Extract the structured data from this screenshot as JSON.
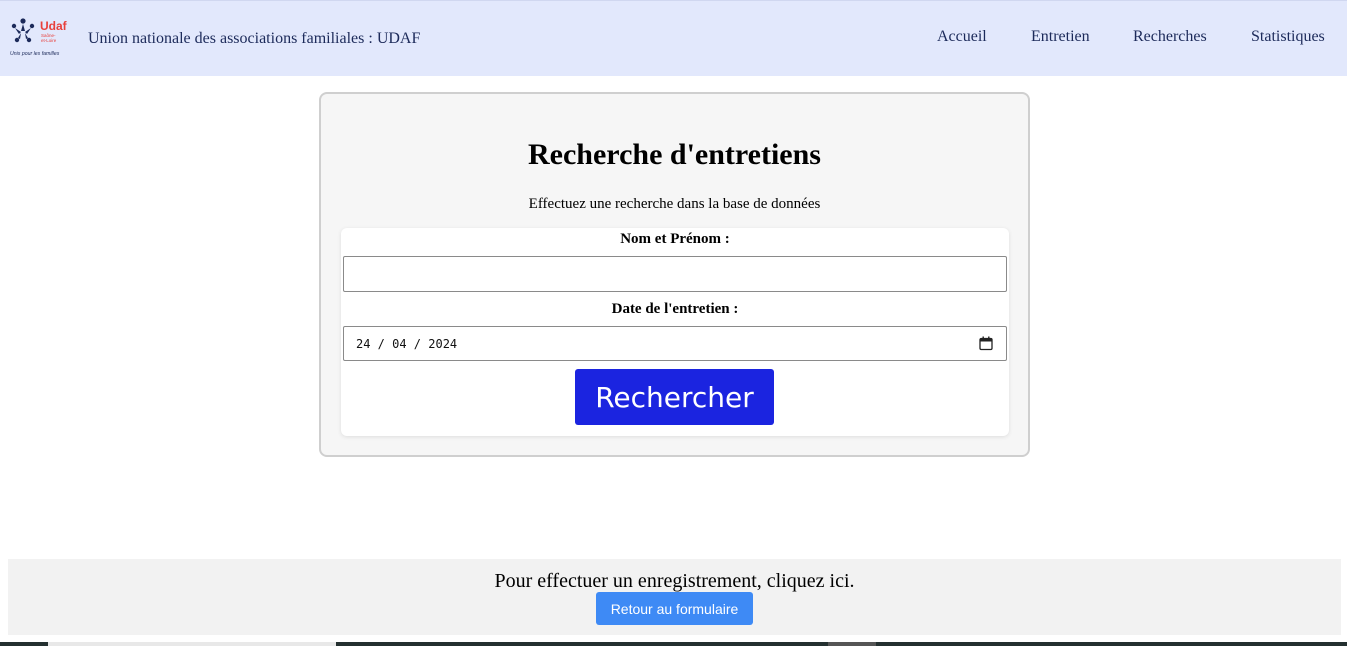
{
  "header": {
    "logo": {
      "brand": "Udaf",
      "region_line1": "Saône-",
      "region_line2": "et-Loire",
      "tagline": "Unis pour les familles"
    },
    "site_title": "Union nationale des associations familiales : UDAF",
    "nav": [
      {
        "label": "Accueil"
      },
      {
        "label": "Entretien"
      },
      {
        "label": "Recherches"
      },
      {
        "label": "Statistiques"
      }
    ]
  },
  "search": {
    "title": "Recherche d'entretiens",
    "subtitle": "Effectuez une recherche dans la base de données",
    "name_label": "Nom et Prénom :",
    "name_value": "",
    "date_label": "Date de l'entretien :",
    "date_value": "24 / 04 / 2024",
    "submit_label": "Rechercher"
  },
  "footer": {
    "text": "Pour effectuer un enregistrement, cliquez ici.",
    "button_label": "Retour au formulaire"
  },
  "colors": {
    "navbar_bg": "#e2e8fc",
    "nav_text": "#1c2a5a",
    "primary_button": "#1b24e0",
    "secondary_button": "#3e8af5",
    "logo_red": "#e8403c",
    "logo_navy": "#1c2a5a"
  },
  "icons": {
    "logo": "udaf-logo",
    "date_picker": "calendar-icon"
  }
}
